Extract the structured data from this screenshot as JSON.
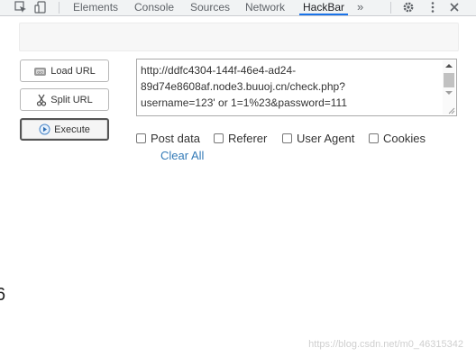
{
  "devtools": {
    "tabs": [
      {
        "label": "Elements",
        "active": false
      },
      {
        "label": "Console",
        "active": false
      },
      {
        "label": "Sources",
        "active": false
      },
      {
        "label": "Network",
        "active": false
      },
      {
        "label": "HackBar",
        "active": true
      }
    ],
    "more_label": "»",
    "icons": [
      "inspect-element-icon",
      "device-toolbar-icon",
      "settings-gear-icon",
      "more-vertical-icon",
      "close-icon"
    ],
    "accent_color": "#1a73e8"
  },
  "hackbar": {
    "buttons": {
      "load": "Load URL",
      "split": "Split URL",
      "execute": "Execute"
    },
    "url_lines": [
      "http://ddfc4304-144f-46e4-ad24-",
      "89d74e8608af.node3.buuoj.cn/check.php?",
      "username=123' or 1=1%23&password=111"
    ],
    "options": {
      "post_data": "Post data",
      "referer": "Referer",
      "user_agent": "User Agent",
      "cookies": "Cookies"
    },
    "clear_all": "Clear All",
    "link_color": "#337ab7"
  },
  "page": {
    "edge_char": "6",
    "watermark": "https://blog.csdn.net/m0_46315342"
  }
}
